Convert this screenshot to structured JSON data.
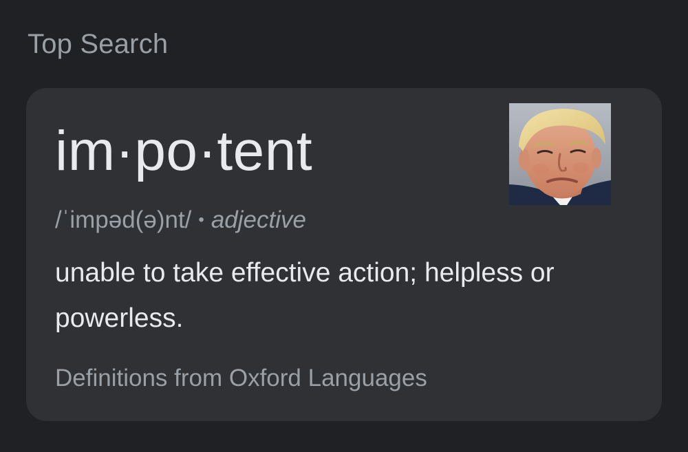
{
  "section": {
    "title": "Top Search"
  },
  "card": {
    "headword": "im·po·tent",
    "pronunciation": "/ˈimpəd(ə)nt/",
    "separator": "•",
    "part_of_speech": "adjective",
    "definition": "unable to take effective action; helpless or powerless.",
    "source": "Definitions from Oxford Languages"
  },
  "colors": {
    "page_background": "#202124",
    "card_background": "#303134",
    "primary_text": "#e8eaed",
    "secondary_text": "#9aa0a6"
  }
}
